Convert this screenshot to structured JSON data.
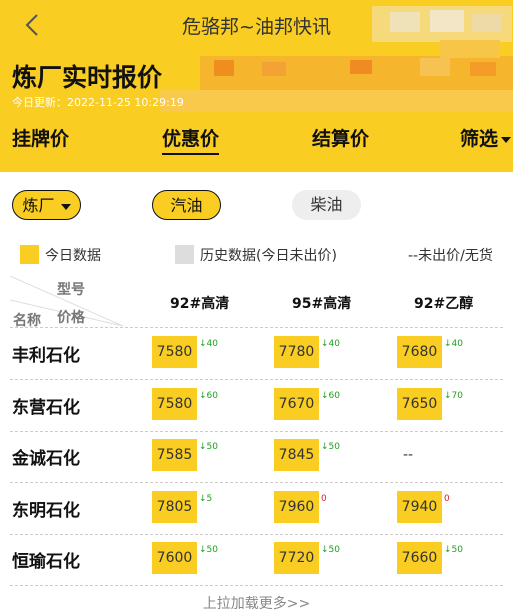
{
  "nav": {
    "title": "危骆邦~油邦快讯"
  },
  "page": {
    "title": "炼厂实时报价",
    "update_time": "今日更新：2022-11-25 10:29:19"
  },
  "tabs": [
    {
      "label": "挂牌价"
    },
    {
      "label": "优惠价",
      "active": true
    },
    {
      "label": "结算价"
    },
    {
      "label": "筛选"
    }
  ],
  "filters": {
    "refinery": "炼厂",
    "gasoline": "汽油",
    "diesel": "柴油"
  },
  "legend": {
    "today": "今日数据",
    "history": "历史数据(今日未出价)",
    "none": "--未出价/无货"
  },
  "table": {
    "corner_type": "型号",
    "corner_name": "名称",
    "corner_price": "价格",
    "columns": [
      "92#高清",
      "95#高清",
      "92#乙醇"
    ],
    "rows": [
      {
        "name": "丰利石化",
        "cells": [
          {
            "price": "7580",
            "delta": "↓40",
            "dir": "down"
          },
          {
            "price": "7780",
            "delta": "↓40",
            "dir": "down"
          },
          {
            "price": "7680",
            "delta": "↓40",
            "dir": "down"
          }
        ]
      },
      {
        "name": "东营石化",
        "cells": [
          {
            "price": "7580",
            "delta": "↓60",
            "dir": "down"
          },
          {
            "price": "7670",
            "delta": "↓60",
            "dir": "down"
          },
          {
            "price": "7650",
            "delta": "↓70",
            "dir": "down"
          }
        ]
      },
      {
        "name": "金诚石化",
        "cells": [
          {
            "price": "7585",
            "delta": "↓50",
            "dir": "down"
          },
          {
            "price": "7845",
            "delta": "↓50",
            "dir": "down"
          },
          {
            "price": "--",
            "delta": "",
            "dir": "none"
          }
        ]
      },
      {
        "name": "东明石化",
        "cells": [
          {
            "price": "7805",
            "delta": "↓5",
            "dir": "down"
          },
          {
            "price": "7960",
            "delta": "0",
            "dir": "flat"
          },
          {
            "price": "7940",
            "delta": "0",
            "dir": "flat"
          }
        ]
      },
      {
        "name": "恒瑜石化",
        "cells": [
          {
            "price": "7600",
            "delta": "↓50",
            "dir": "down"
          },
          {
            "price": "7720",
            "delta": "↓50",
            "dir": "down"
          },
          {
            "price": "7660",
            "delta": "↓50",
            "dir": "down"
          }
        ]
      }
    ]
  },
  "footer": {
    "load_more": "上拉加载更多>>"
  },
  "colors": {
    "accent": "#f9cd22",
    "down": "#20a020",
    "flat": "#e02020"
  },
  "icons": {
    "back": "chevron-left-icon",
    "dropdown": "caret-down-icon"
  }
}
